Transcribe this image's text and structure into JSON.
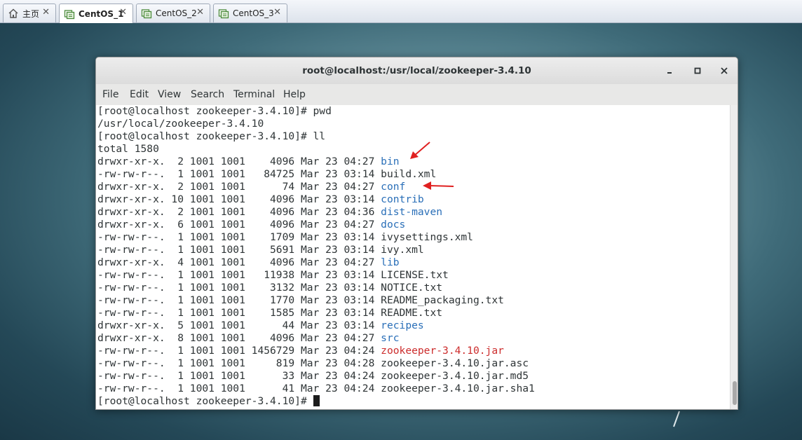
{
  "tabs": [
    {
      "label": "主页",
      "icon": "home-icon",
      "active": false
    },
    {
      "label": "CentOS_1",
      "icon": "vm-icon",
      "active": true
    },
    {
      "label": "CentOS_2",
      "icon": "vm-icon",
      "active": false
    },
    {
      "label": "CentOS_3",
      "icon": "vm-icon",
      "active": false
    }
  ],
  "window": {
    "title": "root@localhost:/usr/local/zookeeper-3.4.10",
    "minimize": "–",
    "maximize": "□",
    "close": "✕"
  },
  "menu": [
    "File",
    "Edit",
    "View",
    "Search",
    "Terminal",
    "Help"
  ],
  "terminal": {
    "lines": [
      {
        "text": "[root@localhost zookeeper-3.4.10]# pwd"
      },
      {
        "text": "/usr/local/zookeeper-3.4.10"
      },
      {
        "text": "[root@localhost zookeeper-3.4.10]# ll"
      },
      {
        "text": "total 1580"
      },
      {
        "text": "drwxr-xr-x.  2 1001 1001    4096 Mar 23 04:27 ",
        "name": "bin",
        "kind": "dir"
      },
      {
        "text": "-rw-rw-r--.  1 1001 1001   84725 Mar 23 03:14 ",
        "name": "build.xml",
        "kind": "file"
      },
      {
        "text": "drwxr-xr-x.  2 1001 1001      74 Mar 23 04:27 ",
        "name": "conf",
        "kind": "dir"
      },
      {
        "text": "drwxr-xr-x. 10 1001 1001    4096 Mar 23 03:14 ",
        "name": "contrib",
        "kind": "dir"
      },
      {
        "text": "drwxr-xr-x.  2 1001 1001    4096 Mar 23 04:36 ",
        "name": "dist-maven",
        "kind": "dir"
      },
      {
        "text": "drwxr-xr-x.  6 1001 1001    4096 Mar 23 04:27 ",
        "name": "docs",
        "kind": "dir"
      },
      {
        "text": "-rw-rw-r--.  1 1001 1001    1709 Mar 23 03:14 ",
        "name": "ivysettings.xml",
        "kind": "file"
      },
      {
        "text": "-rw-rw-r--.  1 1001 1001    5691 Mar 23 03:14 ",
        "name": "ivy.xml",
        "kind": "file"
      },
      {
        "text": "drwxr-xr-x.  4 1001 1001    4096 Mar 23 04:27 ",
        "name": "lib",
        "kind": "dir"
      },
      {
        "text": "-rw-rw-r--.  1 1001 1001   11938 Mar 23 03:14 ",
        "name": "LICENSE.txt",
        "kind": "file"
      },
      {
        "text": "-rw-rw-r--.  1 1001 1001    3132 Mar 23 03:14 ",
        "name": "NOTICE.txt",
        "kind": "file"
      },
      {
        "text": "-rw-rw-r--.  1 1001 1001    1770 Mar 23 03:14 ",
        "name": "README_packaging.txt",
        "kind": "file"
      },
      {
        "text": "-rw-rw-r--.  1 1001 1001    1585 Mar 23 03:14 ",
        "name": "README.txt",
        "kind": "file"
      },
      {
        "text": "drwxr-xr-x.  5 1001 1001      44 Mar 23 03:14 ",
        "name": "recipes",
        "kind": "dir"
      },
      {
        "text": "drwxr-xr-x.  8 1001 1001    4096 Mar 23 04:27 ",
        "name": "src",
        "kind": "dir"
      },
      {
        "text": "-rw-rw-r--.  1 1001 1001 1456729 Mar 23 04:24 ",
        "name": "zookeeper-3.4.10.jar",
        "kind": "archive"
      },
      {
        "text": "-rw-rw-r--.  1 1001 1001     819 Mar 23 04:28 ",
        "name": "zookeeper-3.4.10.jar.asc",
        "kind": "file"
      },
      {
        "text": "-rw-rw-r--.  1 1001 1001      33 Mar 23 04:24 ",
        "name": "zookeeper-3.4.10.jar.md5",
        "kind": "file"
      },
      {
        "text": "-rw-rw-r--.  1 1001 1001      41 Mar 23 04:24 ",
        "name": "zookeeper-3.4.10.jar.sha1",
        "kind": "file"
      }
    ],
    "prompt": "[root@localhost zookeeper-3.4.10]# "
  },
  "colors": {
    "dir": "#2a6fb8",
    "archive": "#cc2c2c",
    "annotation_arrow": "#e02020"
  }
}
